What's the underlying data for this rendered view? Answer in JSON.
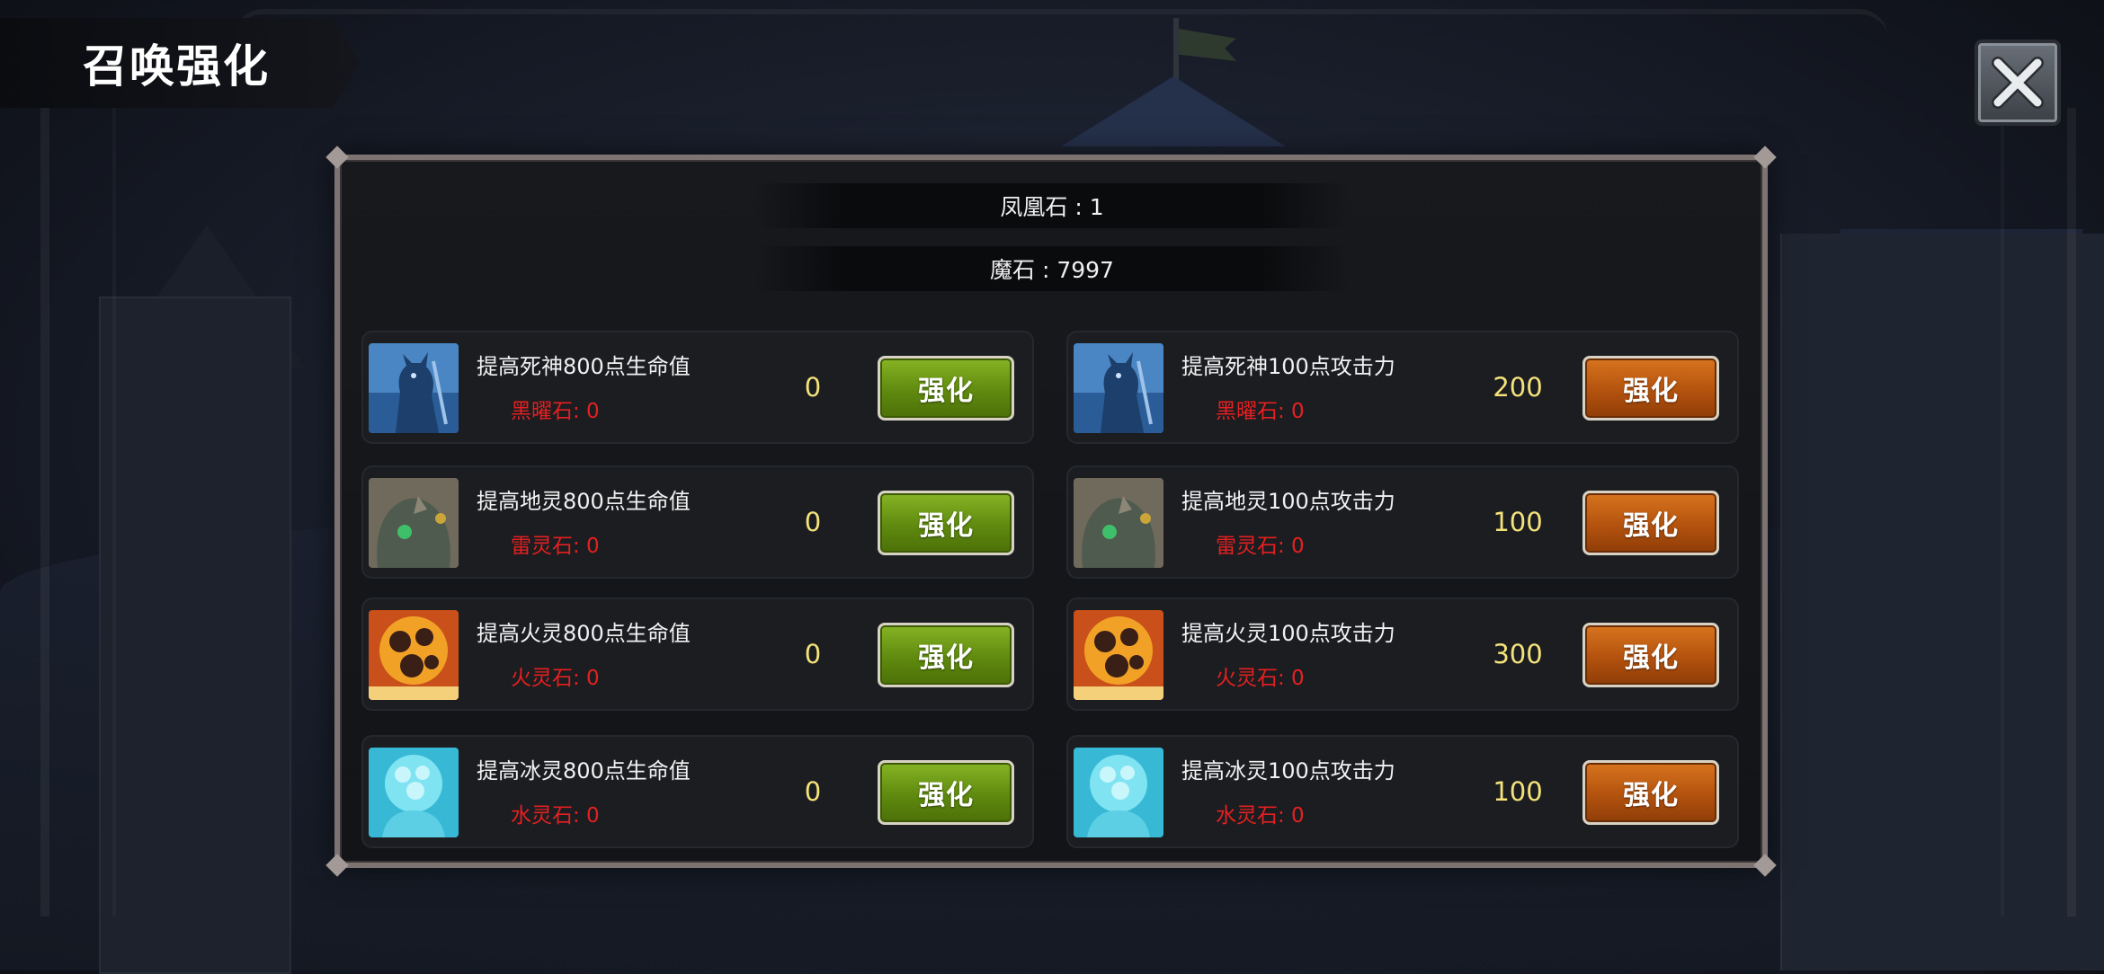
{
  "header": {
    "title": "召唤强化"
  },
  "close": {
    "icon": "close-icon"
  },
  "resources": {
    "phoenix_stone": "凤凰石 : 1",
    "magic_stone": "魔石 : 7997"
  },
  "colors": {
    "value_text": "#f4e27a",
    "cost_text": "#e52020",
    "hp_button": "#6b9a14",
    "atk_button": "#c0601a"
  },
  "upgrades": {
    "hp": [
      {
        "title": "提高死神800点生命值",
        "cost": "黑曜石: 0",
        "value": "0",
        "button": "强化",
        "portrait": "reaper-portrait"
      },
      {
        "title": "提高地灵800点生命值",
        "cost": "雷灵石: 0",
        "value": "0",
        "button": "强化",
        "portrait": "earth-spirit-portrait"
      },
      {
        "title": "提高火灵800点生命值",
        "cost": "火灵石: 0",
        "value": "0",
        "button": "强化",
        "portrait": "fire-spirit-portrait"
      },
      {
        "title": "提高冰灵800点生命值",
        "cost": "水灵石: 0",
        "value": "0",
        "button": "强化",
        "portrait": "ice-spirit-portrait"
      }
    ],
    "atk": [
      {
        "title": "提高死神100点攻击力",
        "cost": "黑曜石: 0",
        "value": "200",
        "button": "强化",
        "portrait": "reaper-portrait"
      },
      {
        "title": "提高地灵100点攻击力",
        "cost": "雷灵石: 0",
        "value": "100",
        "button": "强化",
        "portrait": "earth-spirit-portrait"
      },
      {
        "title": "提高火灵100点攻击力",
        "cost": "火灵石: 0",
        "value": "300",
        "button": "强化",
        "portrait": "fire-spirit-portrait"
      },
      {
        "title": "提高冰灵100点攻击力",
        "cost": "水灵石: 0",
        "value": "100",
        "button": "强化",
        "portrait": "ice-spirit-portrait"
      }
    ]
  }
}
